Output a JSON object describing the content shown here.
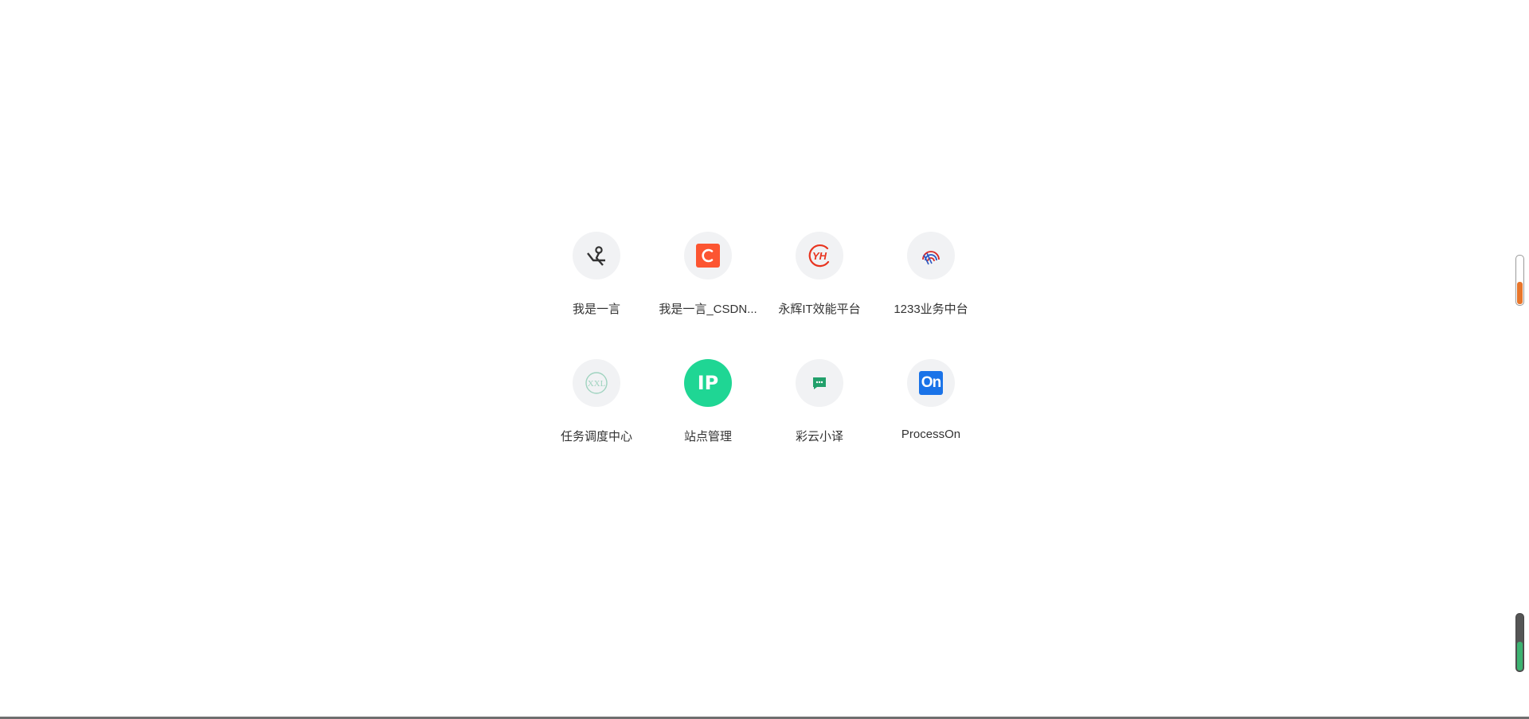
{
  "shortcuts": [
    {
      "label": "我是一言",
      "icon": "writer-sketch-icon"
    },
    {
      "label": "我是一言_CSDN...",
      "icon": "csdn-logo-icon",
      "color": "#fc5531"
    },
    {
      "label": "永辉IT效能平台",
      "icon": "yh-logo-icon",
      "color": "#e8341f"
    },
    {
      "label": "1233业务中台",
      "icon": "rainbow-arcs-icon"
    },
    {
      "label": "任务调度中心",
      "icon": "xxl-logo-icon",
      "icon_text": "XXL"
    },
    {
      "label": "站点管理",
      "icon": "ip-badge-icon",
      "icon_text": "IP",
      "color": "#1fd694"
    },
    {
      "label": "彩云小译",
      "icon": "chat-bubble-icon",
      "color": "#22a06b"
    },
    {
      "label": "ProcessOn",
      "icon": "processon-logo-icon",
      "icon_text": "On",
      "color": "#1a73e8"
    }
  ],
  "side_widgets": {
    "top": {
      "fill_level": 0.45,
      "color": "#e8762b"
    },
    "bottom": {
      "fill_level": 0.5,
      "color": "#3cb371"
    }
  }
}
